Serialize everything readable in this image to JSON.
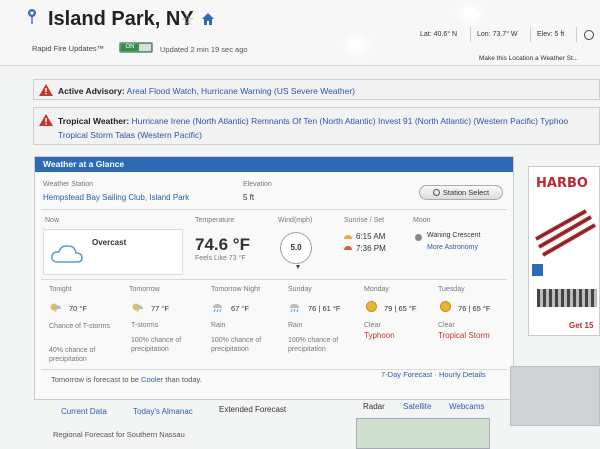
{
  "header": {
    "location": "Island Park, NY",
    "star_icon": "star-icon",
    "home_icon": "home-icon",
    "lat": "Lat: 40.6° N",
    "lon": "Lon: 73.7° W",
    "elev": "Elev: 5 ft",
    "rapid_fire_label": "Rapid Fire Updates™",
    "rapid_fire_state": "ON",
    "updated": "Updated 2 min 19 sec ago",
    "make_location": "Make this Location a Weather St..."
  },
  "alerts": {
    "advisory_label": "Active Advisory:",
    "advisory_items": "Areal Flood Watch,  Hurricane Warning (US Severe Weather)",
    "tropical_label": "Tropical Weather:",
    "tropical_line1": "Hurricane Irene (North Atlantic) Remnants Of Ten (North Atlantic) Invest 91 (North Atlantic) (Western Pacific) Typhoo",
    "tropical_line2": "Tropical Storm Talas (Western Pacific)"
  },
  "glance": {
    "title": "Weather at a Glance",
    "station_label": "Weather Station",
    "station_name": "Hempstead Bay Sailing Club, Island Park",
    "elevation_label": "Elevation",
    "elevation_value": "5 ft",
    "station_select": "Station Select",
    "now_label": "Now",
    "condition": "Overcast",
    "temp_label": "Temperature",
    "temp_value": "74.6 °F",
    "feels_like": "Feels Like 73 °F",
    "wind_label": "Wind(mph)",
    "wind_value": "5.0",
    "sunrise_label": "Sunrise / Set",
    "sunrise": "6:15 AM",
    "sunset": "7:36 PM",
    "moon_label": "Moon",
    "moon_phase": "Waning Crescent",
    "more_astronomy": "More Astronomy",
    "forecast": [
      {
        "period": "Tonight",
        "temp": "70 °F",
        "cond": "Chance of T-storms",
        "extra": "40% chance of precipitation"
      },
      {
        "period": "Tomorrow",
        "temp": "77 °F",
        "cond": "T-storms",
        "extra": "100% chance of precipitation"
      },
      {
        "period": "Tomorrow Night",
        "temp": "67 °F",
        "cond": "Rain",
        "extra": "100% chance of precipitation"
      },
      {
        "period": "Sunday",
        "temp": "76 | 61 °F",
        "cond": "Rain",
        "extra": "100% chance of precipitation"
      },
      {
        "period": "Monday",
        "temp": "79 | 65 °F",
        "cond": "Clear",
        "extra": "Typhoon"
      },
      {
        "period": "Tuesday",
        "temp": "76 | 65 °F",
        "cond": "Clear",
        "extra": "Tropical Storm"
      }
    ],
    "tomorrow_prefix": "Tomorrow is forecast to be",
    "tomorrow_word": "Cooler",
    "tomorrow_suffix": "than today.",
    "seven_day": "7-Day Forecast",
    "sep": " · ",
    "hourly": "Hourly Details",
    "tabs": [
      "Current Data",
      "Today's Almanac",
      "Extended Forecast"
    ],
    "map_tabs": [
      "Radar",
      "Satellite",
      "Webcams"
    ],
    "regional": "Regional Forecast for Southern Nassau"
  },
  "ad": {
    "title": "HARBO",
    "cta": "Get 15"
  },
  "colors": {
    "header_blue": "#2f6bb5",
    "link_blue": "#2b5ea8",
    "alert_red": "#c0392b"
  }
}
